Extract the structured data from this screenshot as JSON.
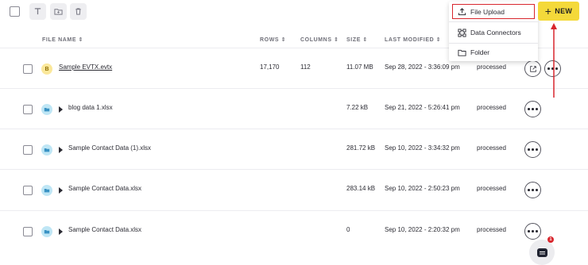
{
  "toolbar": {
    "text_icon": "text-format-icon",
    "folder_icon": "folder-add-icon",
    "trash_icon": "trash-icon"
  },
  "header": {
    "file_name": "FILE NAME ⇕",
    "rows": "ROWS ⇕",
    "columns": "COLUMNS ⇕",
    "size": "SIZE ⇕",
    "last_modified": "LAST MODIFIED ⇕"
  },
  "files": [
    {
      "badge": "B",
      "name": "Sample EVTX.evtx",
      "rows": "17,170",
      "columns": "112",
      "size": "11.07 MB",
      "modified": "Sep 28, 2022 - 3:36:09 pm",
      "status": "processed"
    },
    {
      "badge": "",
      "name": "blog data 1.xlsx",
      "rows": "",
      "columns": "",
      "size": "7.22 kB",
      "modified": "Sep 21, 2022 - 5:26:41 pm",
      "status": "processed"
    },
    {
      "badge": "",
      "name": "Sample Contact Data (1).xlsx",
      "rows": "",
      "columns": "",
      "size": "281.72 kB",
      "modified": "Sep 10, 2022 - 3:34:32 pm",
      "status": "processed"
    },
    {
      "badge": "",
      "name": "Sample Contact Data.xlsx",
      "rows": "",
      "columns": "",
      "size": "283.14 kB",
      "modified": "Sep 10, 2022 - 2:50:23 pm",
      "status": "processed"
    },
    {
      "badge": "",
      "name": "Sample Contact Data.xlsx",
      "rows": "",
      "columns": "",
      "size": "0",
      "modified": "Sep 10, 2022 - 2:20:32 pm",
      "status": "processed"
    }
  ],
  "new_button": {
    "label": "NEW"
  },
  "menu": {
    "file_upload": "File Upload",
    "data_connectors": "Data Connectors",
    "folder": "Folder"
  },
  "colors": {
    "accent_yellow": "#f4d93a",
    "highlight_red": "#d8262d",
    "folder_blue": "#bfe6f5",
    "badge_yellow": "#fbe89b"
  },
  "chat": {
    "badge_count": "1"
  }
}
